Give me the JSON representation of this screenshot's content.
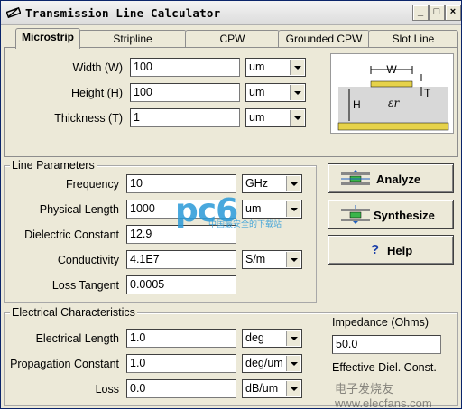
{
  "window": {
    "title": "Transmission Line Calculator"
  },
  "tabs": [
    {
      "label": "Microstrip"
    },
    {
      "label": "Stripline"
    },
    {
      "label": "CPW"
    },
    {
      "label": "Grounded CPW"
    },
    {
      "label": "Slot Line"
    }
  ],
  "geometry": {
    "width_label": "Width (W)",
    "width_value": "100",
    "width_unit": "um",
    "height_label": "Height (H)",
    "height_value": "100",
    "height_unit": "um",
    "thickness_label": "Thickness (T)",
    "thickness_value": "1",
    "thickness_unit": "um",
    "diagram": {
      "w": "W",
      "h": "H",
      "t": "T",
      "er": "εr"
    }
  },
  "line_parameters": {
    "title": "Line Parameters",
    "frequency_label": "Frequency",
    "frequency_value": "10",
    "frequency_unit": "GHz",
    "physical_length_label": "Physical Length",
    "physical_length_value": "1000",
    "physical_length_unit": "um",
    "dielectric_label": "Dielectric Constant",
    "dielectric_value": "12.9",
    "conductivity_label": "Conductivity",
    "conductivity_value": "4.1E7",
    "conductivity_unit": "S/m",
    "loss_tangent_label": "Loss Tangent",
    "loss_tangent_value": "0.0005"
  },
  "buttons": {
    "analyze": "Analyze",
    "synthesize": "Synthesize",
    "help": "Help"
  },
  "electrical": {
    "title": "Electrical Characteristics",
    "electrical_length_label": "Electrical Length",
    "electrical_length_value": "1.0",
    "electrical_length_unit": "deg",
    "propagation_label": "Propagation Constant",
    "propagation_value": "1.0",
    "propagation_unit": "deg/um",
    "loss_label": "Loss",
    "loss_value": "0.0",
    "loss_unit": "dB/um",
    "impedance_label": "Impedance (Ohms)",
    "impedance_value": "50.0",
    "eff_diel_label": "Effective Diel. Const."
  },
  "watermarks": {
    "brand": "pc6",
    "brand_sub": "中国最安全的下载站",
    "site": "电子发烧友 www.elecfans.com"
  }
}
